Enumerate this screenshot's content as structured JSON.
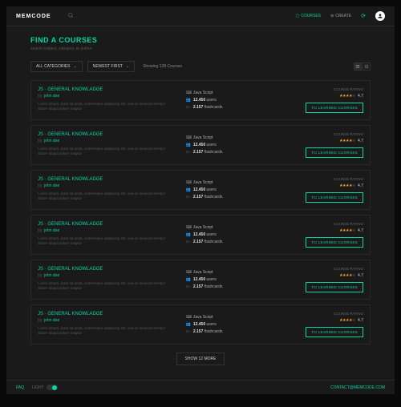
{
  "header": {
    "logo": "MEMCODE",
    "nav": {
      "courses": "COURSES",
      "create": "CREATE"
    }
  },
  "page": {
    "title": "FIND A COURSES",
    "subtitle": "search subject, category, or author"
  },
  "filters": {
    "category": "ALL CATEGORIES",
    "sort": "NEWEST FIRST",
    "results": "Showing 128 Courses"
  },
  "course": {
    "num": "JS",
    "sep": " - ",
    "name": "GENERAL KNOWLADGE",
    "by": "by: ",
    "author": "john doe",
    "desc": "Lorem ipsum, dolor sit amet, consectetur adipiscing elit, sed do eiusmod tempor dolore aliqua dolore magna",
    "lang": "Java Script",
    "users": "12.450",
    "users_suffix": " users",
    "cards": "2.157",
    "cards_suffix": " flashcards",
    "rating_label": "COURSE RATING",
    "rating": "4.7",
    "btn": "TO LEARNED CUORSES"
  },
  "show_more": "SHOW 12 MORE",
  "footer": {
    "faq": "FAQ",
    "light": "LIGHT",
    "contact": "CONTACT@MEMCODE.COM"
  }
}
